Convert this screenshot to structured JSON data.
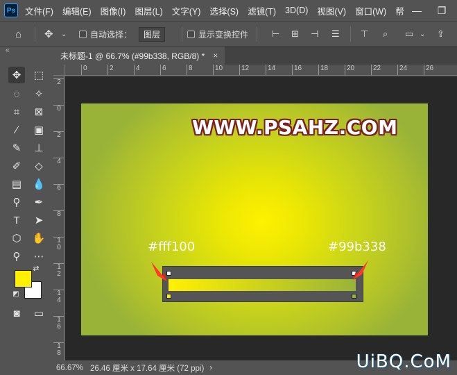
{
  "app": {
    "logo": "Ps"
  },
  "menu": [
    "文件(F)",
    "编辑(E)",
    "图像(I)",
    "图层(L)",
    "文字(Y)",
    "选择(S)",
    "滤镜(T)",
    "3D(D)",
    "视图(V)",
    "窗口(W)",
    "帮"
  ],
  "window_controls": {
    "minimize": "—",
    "restore": "❐"
  },
  "options": {
    "auto_select_label": "自动选择：",
    "auto_select_value": "图层",
    "show_transform_label": "显示变换控件"
  },
  "tab": {
    "title": "未标题-1 @ 66.7% (#99b338, RGB/8) *",
    "close": "×"
  },
  "ruler_h": [
    "0",
    "2",
    "4",
    "6",
    "8",
    "10",
    "12",
    "14",
    "16",
    "18",
    "20",
    "22",
    "24",
    "26"
  ],
  "ruler_v": [
    "2",
    "0",
    "2",
    "4",
    "6",
    "8",
    "1\n0",
    "1\n2",
    "1\n4",
    "1\n6",
    "1\n8"
  ],
  "canvas": {
    "site_title": "WWW.PSAHZ.COM",
    "left_color_label": "#fff100",
    "right_color_label": "#99b338",
    "gradient_start": "#fff100",
    "gradient_end": "#99b338"
  },
  "swatches": {
    "foreground": "#fff100",
    "background": "#ffffff"
  },
  "status": {
    "zoom": "66.67%",
    "doc_size": "26.46 厘米 x 17.64 厘米 (72 ppi)",
    "arrow": "›"
  },
  "watermark": "UiBQ.CoM"
}
